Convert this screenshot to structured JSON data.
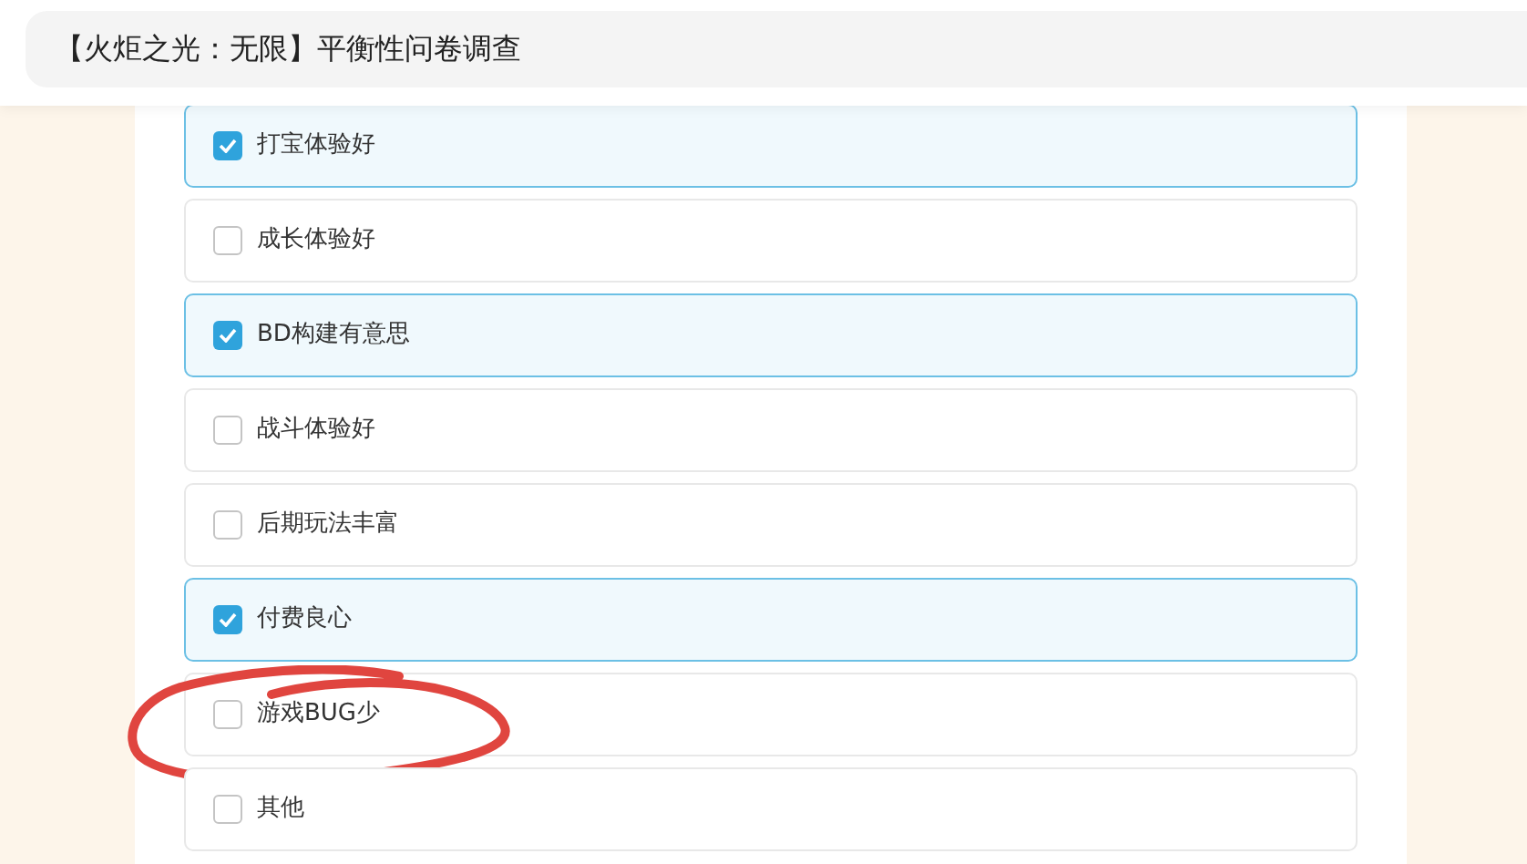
{
  "header": {
    "title": "【火炬之光：无限】平衡性问卷调查"
  },
  "options": [
    {
      "label": "打宝体验好",
      "checked": true,
      "circled": false
    },
    {
      "label": "成长体验好",
      "checked": false,
      "circled": false
    },
    {
      "label": "BD构建有意思",
      "checked": true,
      "circled": false
    },
    {
      "label": "战斗体验好",
      "checked": false,
      "circled": false
    },
    {
      "label": "后期玩法丰富",
      "checked": false,
      "circled": false
    },
    {
      "label": "付费良心",
      "checked": true,
      "circled": false
    },
    {
      "label": "游戏BUG少",
      "checked": false,
      "circled": true
    },
    {
      "label": "其他",
      "checked": false,
      "circled": false
    }
  ]
}
